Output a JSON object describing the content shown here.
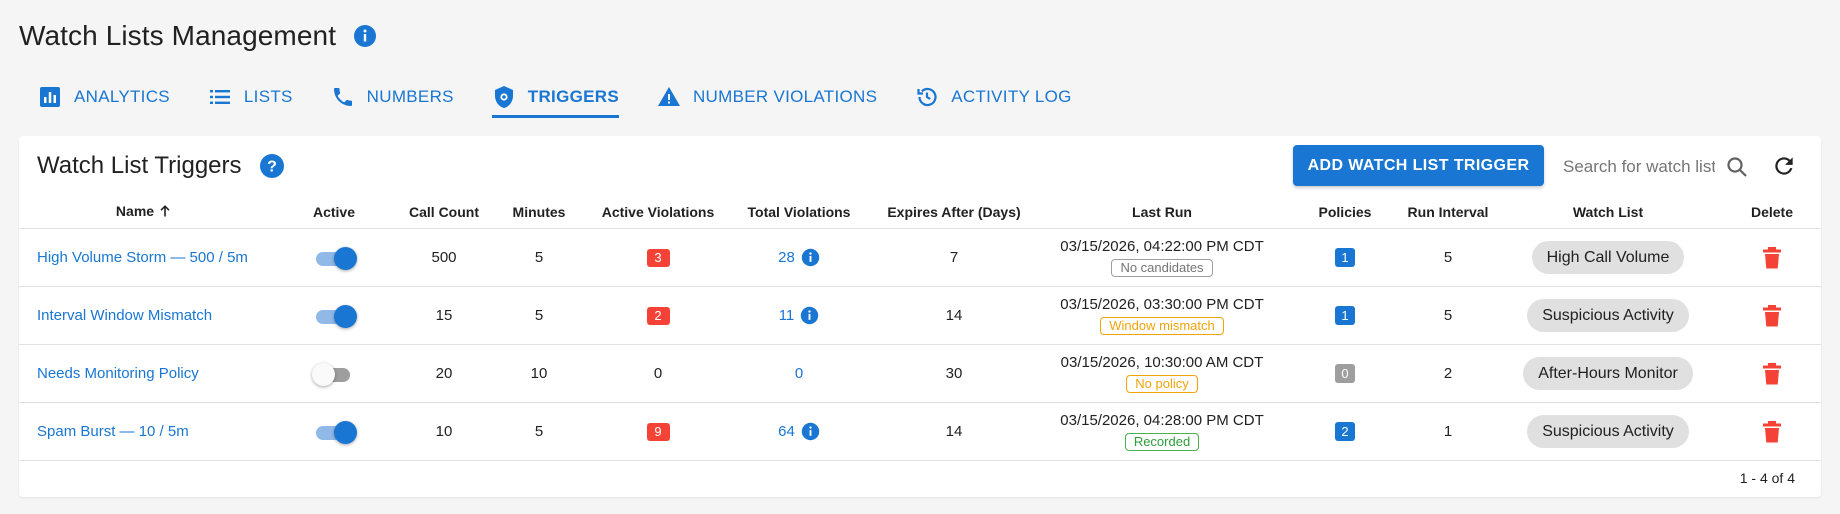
{
  "page": {
    "title": "Watch Lists Management"
  },
  "tabs": [
    {
      "label": "ANALYTICS",
      "icon": "analytics-icon"
    },
    {
      "label": "LISTS",
      "icon": "list-icon"
    },
    {
      "label": "NUMBERS",
      "icon": "phone-icon"
    },
    {
      "label": "TRIGGERS",
      "icon": "shield-icon",
      "active": true
    },
    {
      "label": "NUMBER VIOLATIONS",
      "icon": "warning-icon"
    },
    {
      "label": "ACTIVITY LOG",
      "icon": "history-icon"
    }
  ],
  "card": {
    "title": "Watch List Triggers",
    "add_button": "ADD WATCH LIST TRIGGER",
    "search_placeholder": "Search for watch list triggers"
  },
  "table": {
    "columns": [
      "Name",
      "Active",
      "Call Count",
      "Minutes",
      "Active Violations",
      "Total Violations",
      "Expires After (Days)",
      "Last Run",
      "Policies",
      "Run Interval",
      "Watch List",
      "Delete"
    ],
    "rows": [
      {
        "name": "High Volume Storm — 500 / 5m",
        "active": true,
        "call_count": "500",
        "minutes": "5",
        "active_violations": "3",
        "total_violations": "28",
        "expires_after": "7",
        "last_run": "03/15/2026, 04:22:00 PM CDT",
        "status": "No candidates",
        "status_color": "grey",
        "policies": "1",
        "run_interval": "5",
        "watch_list": "High Call Volume"
      },
      {
        "name": "Interval Window Mismatch",
        "active": true,
        "call_count": "15",
        "minutes": "5",
        "active_violations": "2",
        "total_violations": "11",
        "expires_after": "14",
        "last_run": "03/15/2026, 03:30:00 PM CDT",
        "status": "Window mismatch",
        "status_color": "orange",
        "policies": "1",
        "run_interval": "5",
        "watch_list": "Suspicious Activity"
      },
      {
        "name": "Needs Monitoring Policy",
        "active": false,
        "call_count": "20",
        "minutes": "10",
        "active_violations": "0",
        "total_violations": "0",
        "expires_after": "30",
        "last_run": "03/15/2026, 10:30:00 AM CDT",
        "status": "No policy",
        "status_color": "orange",
        "policies": "0",
        "run_interval": "2",
        "watch_list": "After-Hours Monitor"
      },
      {
        "name": "Spam Burst — 10 / 5m",
        "active": true,
        "call_count": "10",
        "minutes": "5",
        "active_violations": "9",
        "total_violations": "64",
        "expires_after": "14",
        "last_run": "03/15/2026, 04:28:00 PM CDT",
        "status": "Recorded",
        "status_color": "green",
        "policies": "2",
        "run_interval": "1",
        "watch_list": "Suspicious Activity"
      }
    ]
  },
  "pagination": {
    "text": "1 - 4 of 4"
  },
  "colors": {
    "primary": "#1976d2",
    "danger": "#f44336",
    "background": "#f5f5f5"
  }
}
